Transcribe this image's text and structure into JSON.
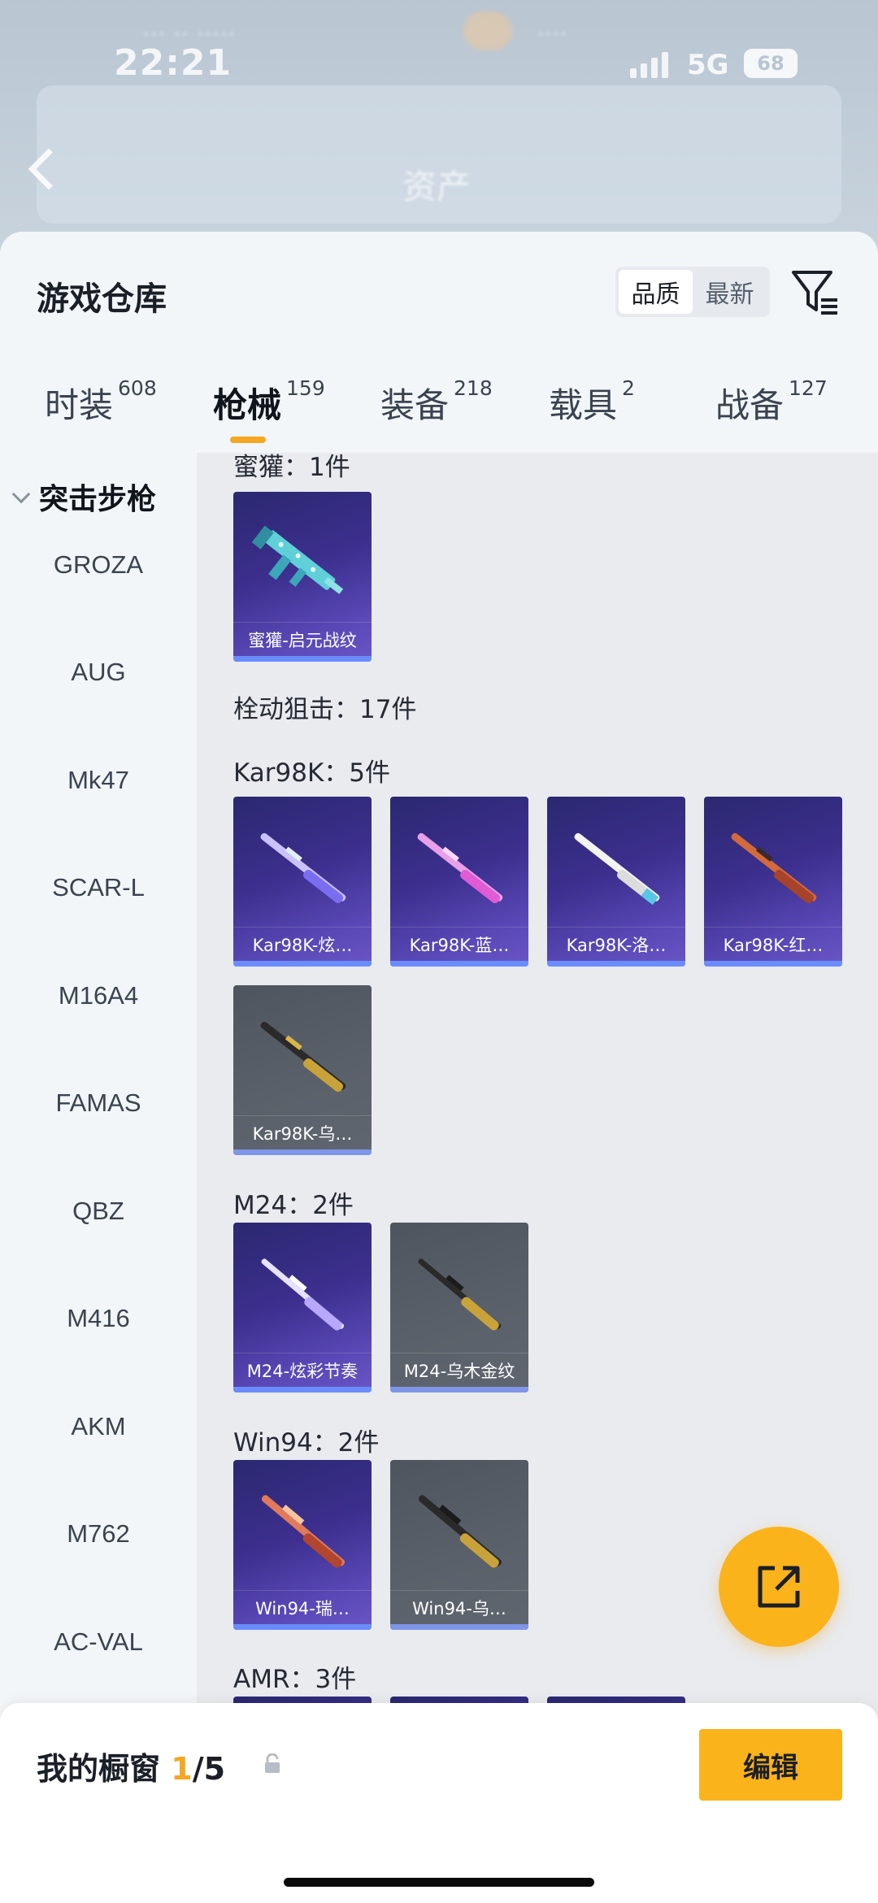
{
  "status_bar": {
    "time": "22:21",
    "network": "5G",
    "battery": "68"
  },
  "nav": {
    "title": "资产",
    "back_icon": "chevron-left-icon"
  },
  "header": {
    "title": "游戏仓库",
    "sort_options": [
      "品质",
      "最新"
    ],
    "sort_active": "品质",
    "filter_icon": "filter-icon"
  },
  "tabs": [
    {
      "label": "时装",
      "count": "608"
    },
    {
      "label": "枪械",
      "count": "159",
      "active": true
    },
    {
      "label": "装备",
      "count": "218"
    },
    {
      "label": "载具",
      "count": "2"
    },
    {
      "label": "战备",
      "count": "127"
    }
  ],
  "sidebar": {
    "group_label": "突击步枪",
    "items": [
      "GROZA",
      "AUG",
      "Mk47",
      "SCAR-L",
      "M16A4",
      "FAMAS",
      "QBZ",
      "M416",
      "AKM",
      "M762",
      "AC-VAL"
    ]
  },
  "sections": [
    {
      "title": "蜜獾：1件",
      "items": [
        {
          "label": "蜜獾-启元战纹",
          "rarity": "purple"
        }
      ]
    },
    {
      "title": "栓动狙击：17件",
      "items": []
    },
    {
      "title": "Kar98K：5件",
      "items": [
        {
          "label": "Kar98K-炫…",
          "rarity": "purple"
        },
        {
          "label": "Kar98K-蓝…",
          "rarity": "purple"
        },
        {
          "label": "Kar98K-洛…",
          "rarity": "purple"
        },
        {
          "label": "Kar98K-红…",
          "rarity": "purple"
        },
        {
          "label": "Kar98K-乌…",
          "rarity": "gray"
        }
      ]
    },
    {
      "title": "M24：2件",
      "items": [
        {
          "label": "M24-炫彩节奏",
          "rarity": "purple"
        },
        {
          "label": "M24-乌木金纹",
          "rarity": "gray"
        }
      ]
    },
    {
      "title": "Win94：2件",
      "items": [
        {
          "label": "Win94-瑞…",
          "rarity": "purple"
        },
        {
          "label": "Win94-乌…",
          "rarity": "gray"
        }
      ]
    },
    {
      "title": "AMR：3件",
      "items": []
    }
  ],
  "fab": {
    "icon": "share-icon"
  },
  "showcase": {
    "title": "我的橱窗",
    "current": "1",
    "total": "/5",
    "lock_icon": "lock-icon",
    "edit_label": "编辑"
  },
  "colors": {
    "accent": "#fbb31c",
    "purple_card": "#3c2f8e",
    "gray_card": "#5b616a"
  }
}
